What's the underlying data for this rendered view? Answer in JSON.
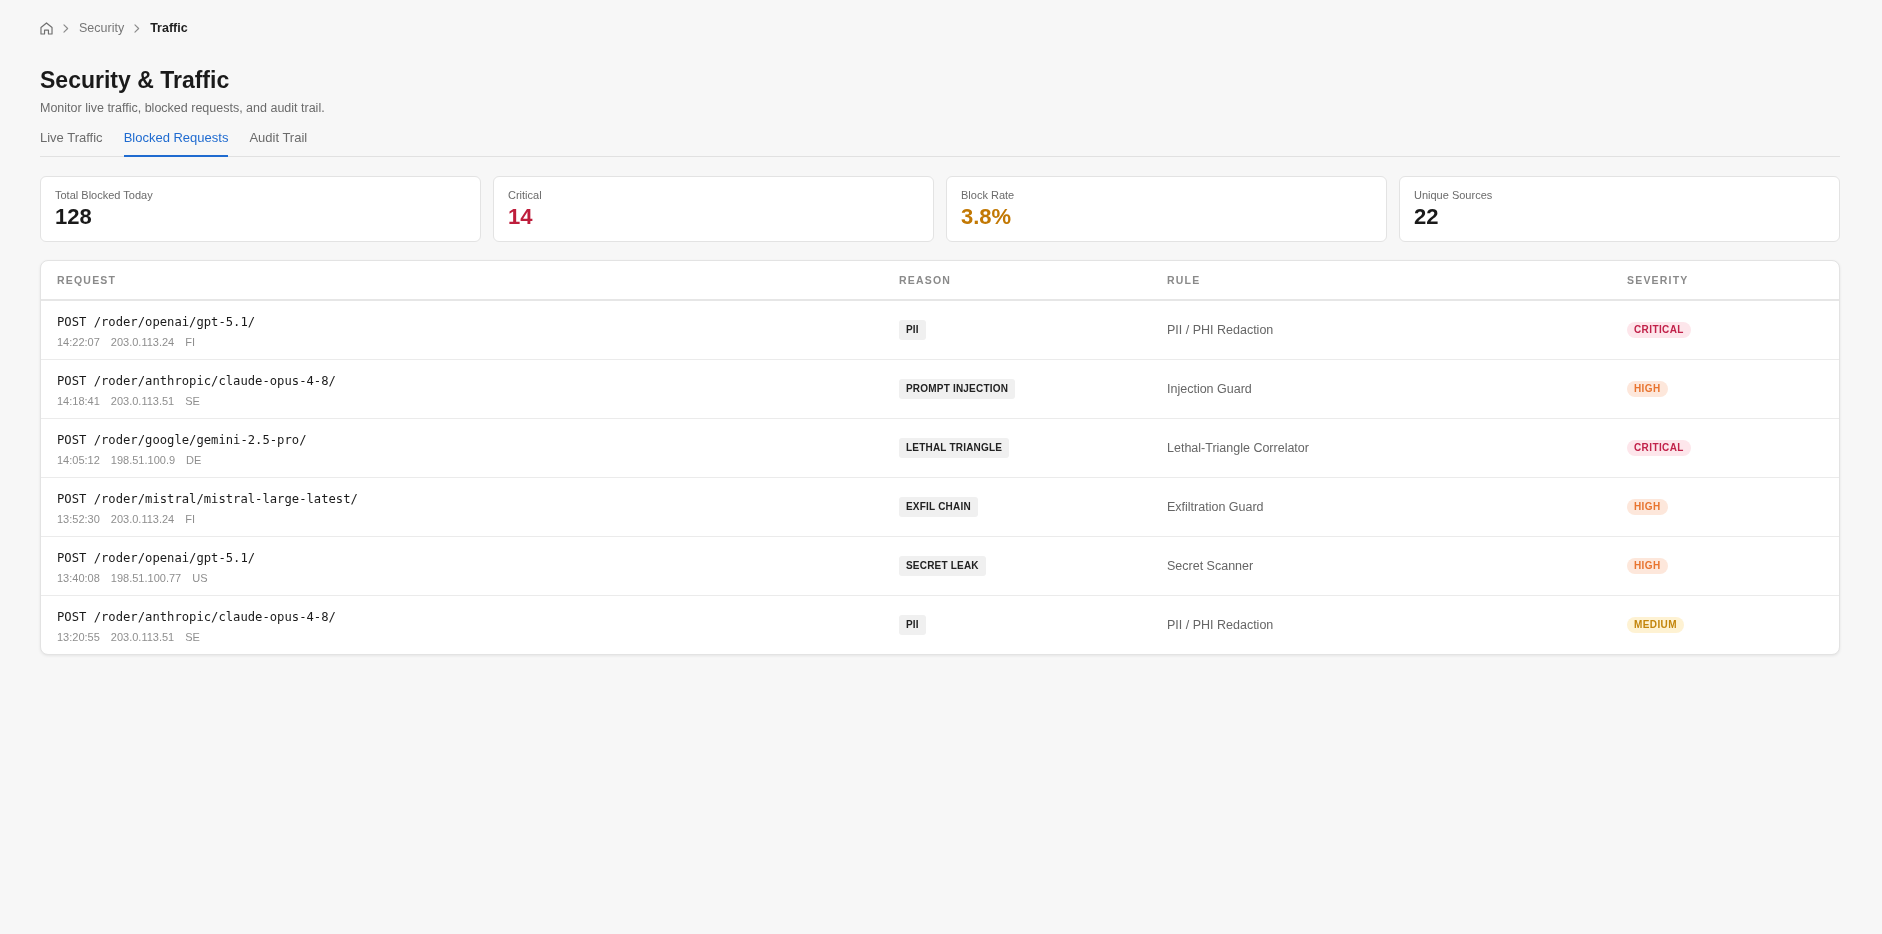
{
  "breadcrumb": {
    "items": [
      {
        "label": "Security",
        "current": false
      },
      {
        "label": "Traffic",
        "current": true
      }
    ]
  },
  "page": {
    "title": "Security & Traffic",
    "subtitle": "Monitor live traffic, blocked requests, and audit trail."
  },
  "tabs": [
    {
      "label": "Live Traffic",
      "selected": false
    },
    {
      "label": "Blocked Requests",
      "selected": true
    },
    {
      "label": "Audit Trail",
      "selected": false
    }
  ],
  "stats": [
    {
      "label": "Total Blocked Today",
      "value": "128",
      "color": "#1a1a1a"
    },
    {
      "label": "Critical",
      "value": "14",
      "color": "#be1e3c"
    },
    {
      "label": "Block Rate",
      "value": "3.8%",
      "color": "#c27803"
    },
    {
      "label": "Unique Sources",
      "value": "22",
      "color": "#1a1a1a"
    }
  ],
  "table": {
    "columns": [
      "REQUEST",
      "REASON",
      "RULE",
      "SEVERITY"
    ],
    "rows": [
      {
        "request": "POST /roder/openai/gpt-5.1/",
        "time": "14:22:07",
        "ip": "203.0.113.24",
        "country": "FI",
        "reason": "PII",
        "rule": "PII / PHI Redaction",
        "severity": {
          "label": "CRITICAL",
          "kind": "critical"
        }
      },
      {
        "request": "POST /roder/anthropic/claude-opus-4-8/",
        "time": "14:18:41",
        "ip": "203.0.113.51",
        "country": "SE",
        "reason": "PROMPT INJECTION",
        "rule": "Injection Guard",
        "severity": {
          "label": "HIGH",
          "kind": "high"
        }
      },
      {
        "request": "POST /roder/google/gemini-2.5-pro/",
        "time": "14:05:12",
        "ip": "198.51.100.9",
        "country": "DE",
        "reason": "LETHAL TRIANGLE",
        "rule": "Lethal-Triangle Correlator",
        "severity": {
          "label": "CRITICAL",
          "kind": "critical"
        }
      },
      {
        "request": "POST /roder/mistral/mistral-large-latest/",
        "time": "13:52:30",
        "ip": "203.0.113.24",
        "country": "FI",
        "reason": "EXFIL CHAIN",
        "rule": "Exfiltration Guard",
        "severity": {
          "label": "HIGH",
          "kind": "high"
        }
      },
      {
        "request": "POST /roder/openai/gpt-5.1/",
        "time": "13:40:08",
        "ip": "198.51.100.77",
        "country": "US",
        "reason": "SECRET LEAK",
        "rule": "Secret Scanner",
        "severity": {
          "label": "HIGH",
          "kind": "high"
        }
      },
      {
        "request": "POST /roder/anthropic/claude-opus-4-8/",
        "time": "13:20:55",
        "ip": "203.0.113.51",
        "country": "SE",
        "reason": "PII",
        "rule": "PII / PHI Redaction",
        "severity": {
          "label": "MEDIUM",
          "kind": "medium"
        }
      }
    ]
  }
}
